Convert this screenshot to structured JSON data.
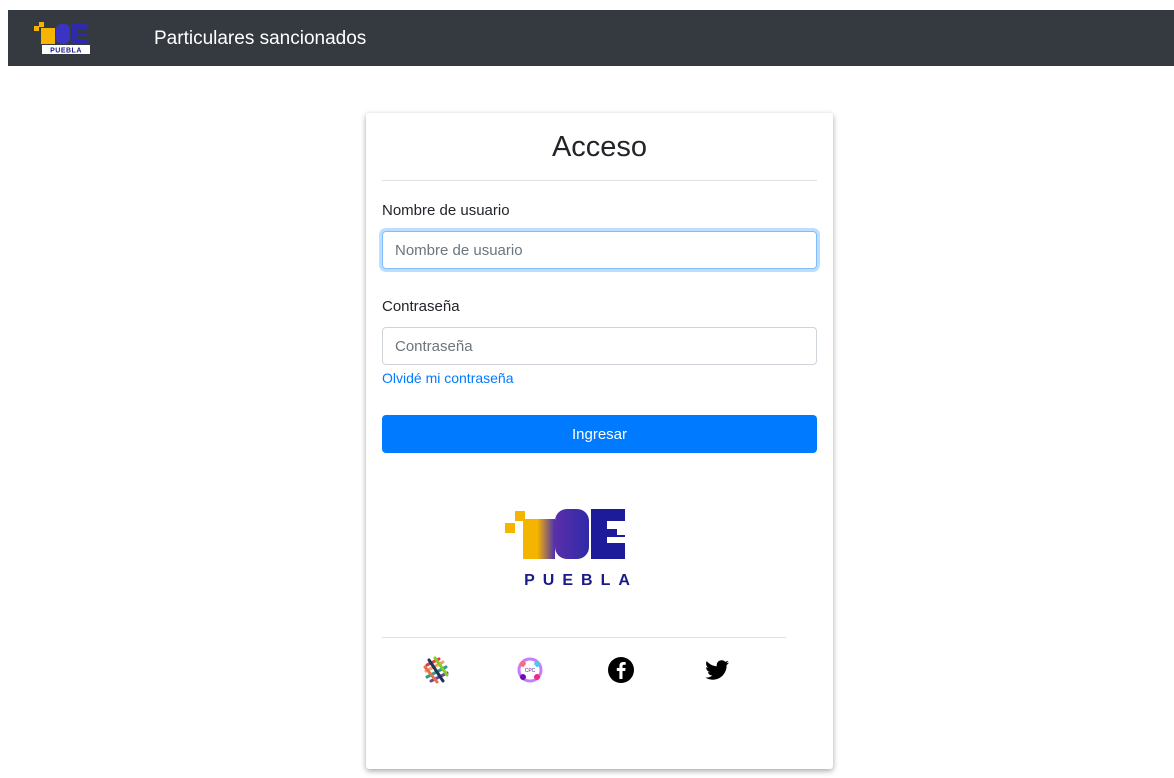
{
  "navbar": {
    "title": "Particulares sancionados",
    "logo_text_top": "PDE",
    "logo_text_bottom": "PUEBLA",
    "background": "#343a40"
  },
  "login": {
    "title": "Acceso",
    "username_label": "Nombre de usuario",
    "username_placeholder": "Nombre de usuario",
    "username_value": "",
    "password_label": "Contraseña",
    "password_placeholder": "Contraseña",
    "password_value": "",
    "forgot_link": "Olvidé mi contraseña",
    "submit_label": "Ingresar",
    "accent": "#007bff"
  },
  "brand": {
    "logo_main": "PDE",
    "logo_sub": "PUEBLA",
    "colors": {
      "yellow": "#f5b400",
      "navy": "#1b1a8a",
      "purple": "#2f2aa8"
    }
  },
  "social": [
    {
      "name": "sna-icon"
    },
    {
      "name": "cpc-icon",
      "label": "CPC"
    },
    {
      "name": "facebook-icon"
    },
    {
      "name": "twitter-icon"
    }
  ]
}
